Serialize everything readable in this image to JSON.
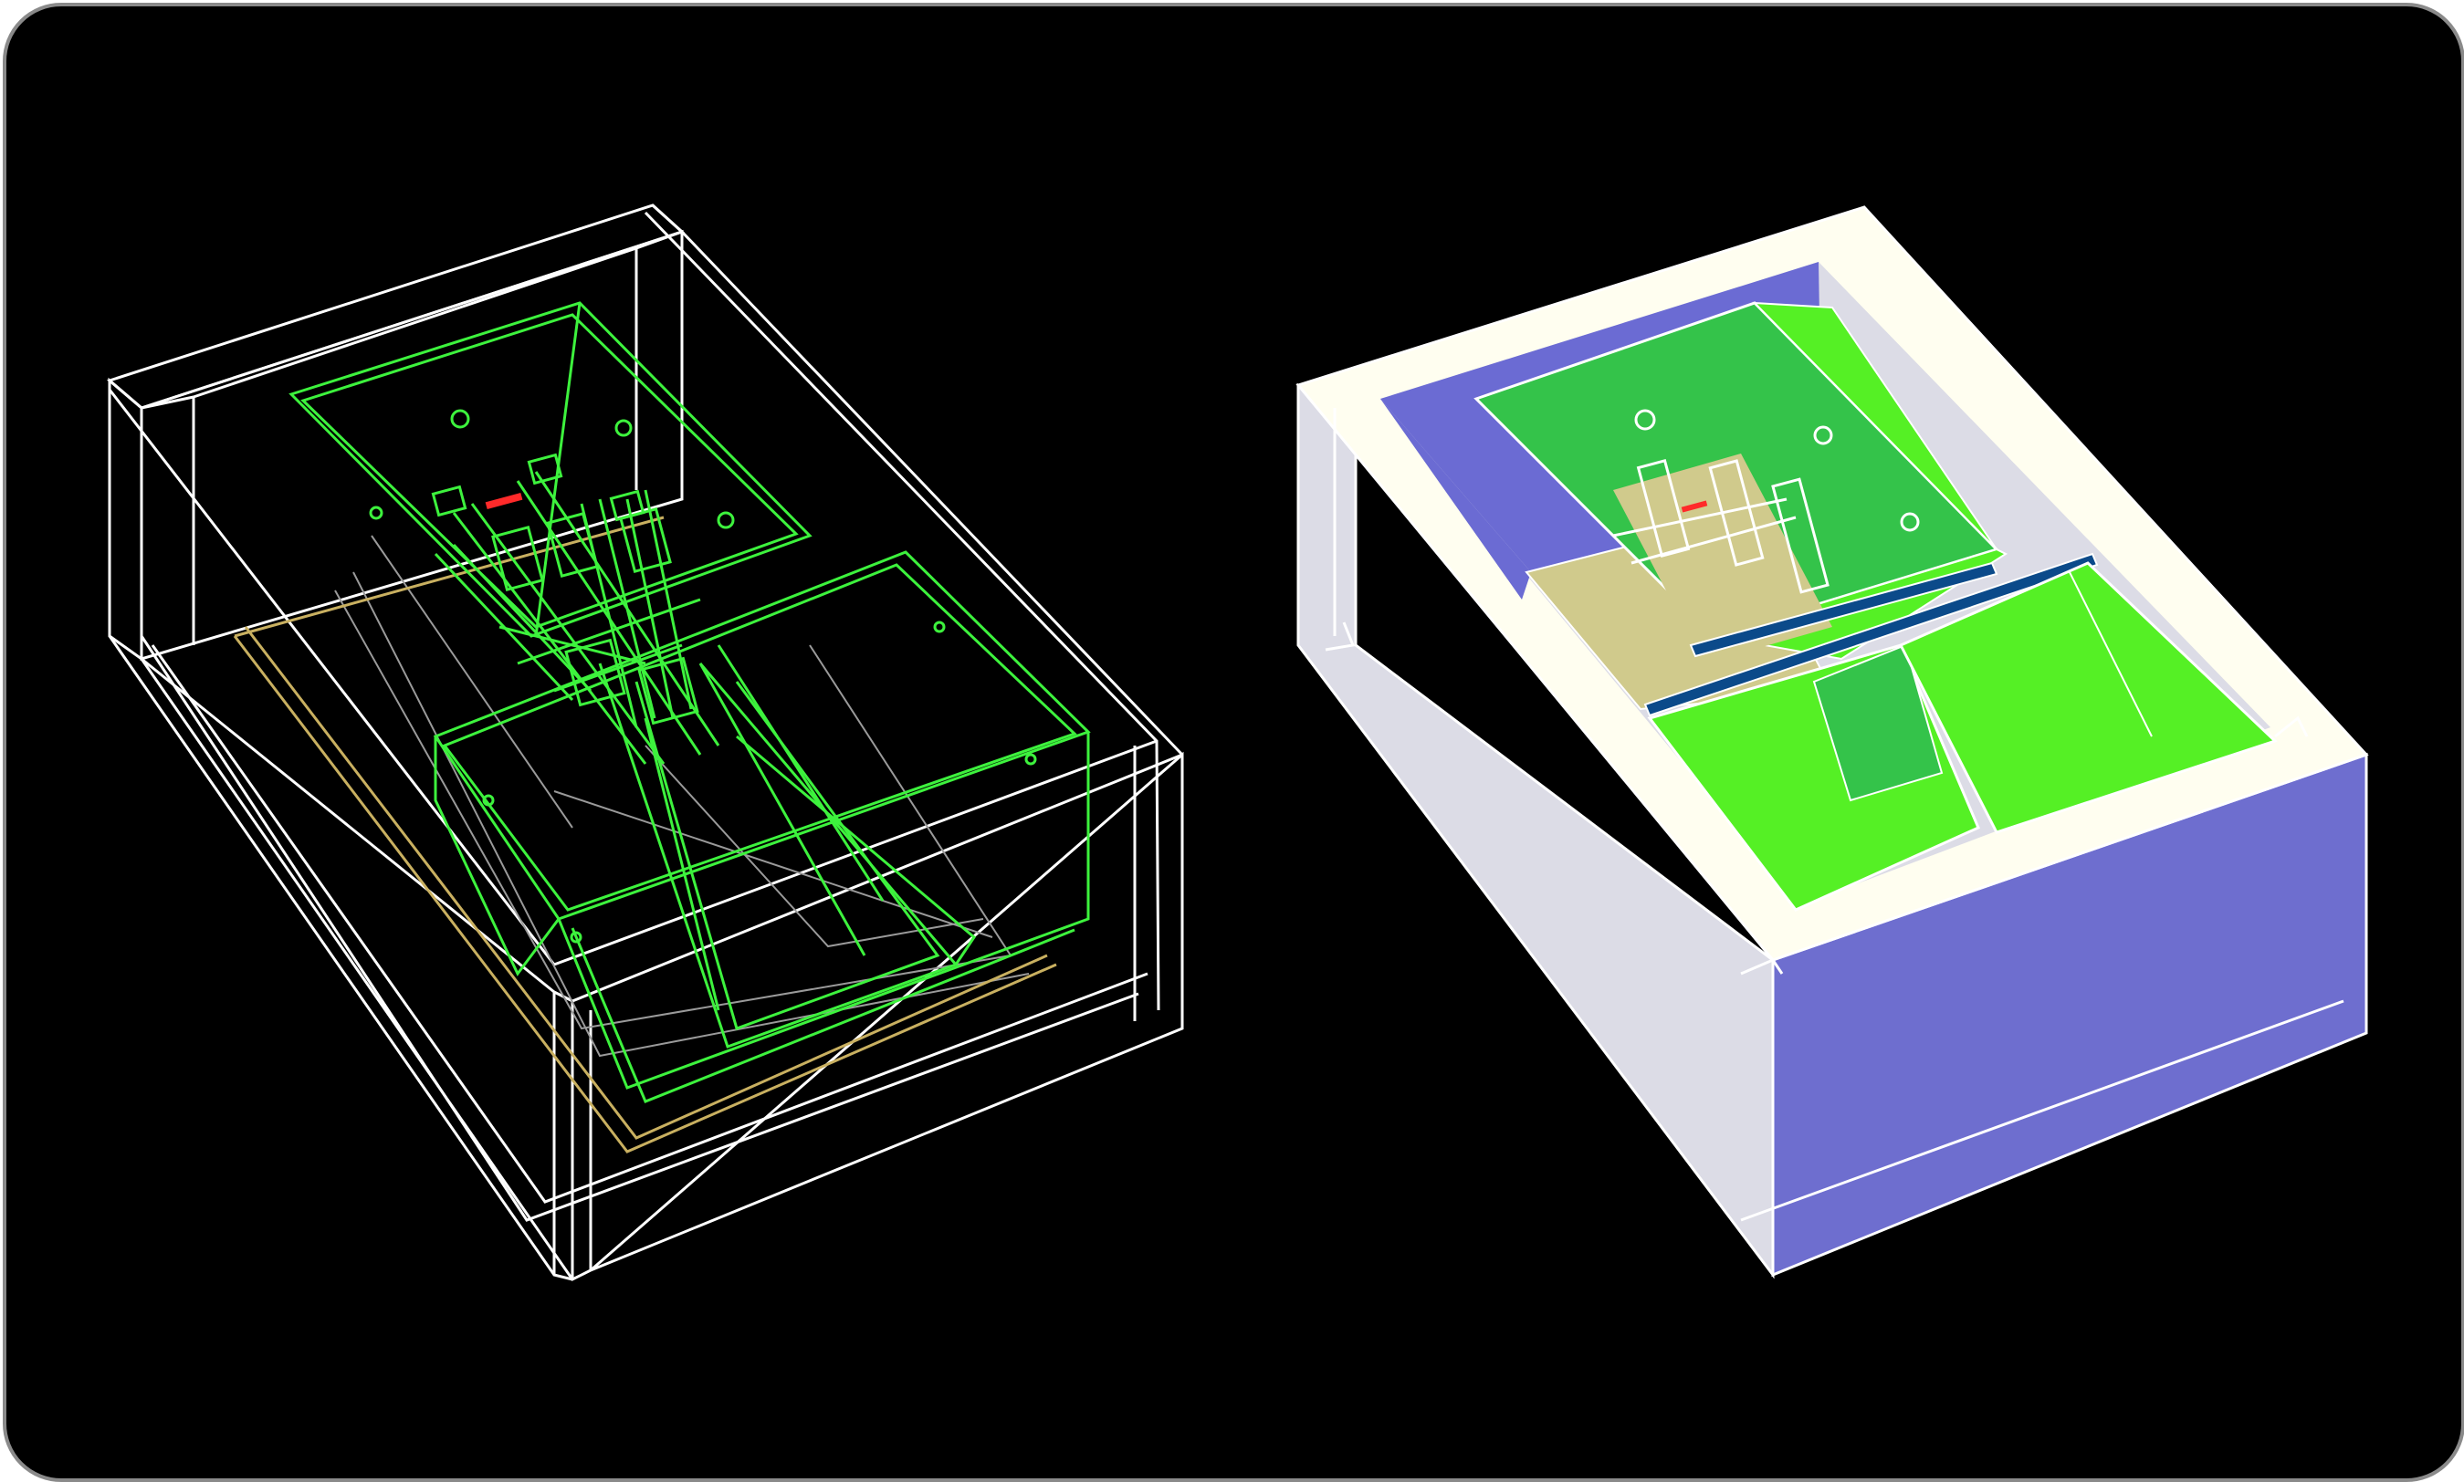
{
  "canvas": {
    "background": "#000000",
    "border_color": "#8a8a8a"
  },
  "views": [
    {
      "name": "wireframe-view",
      "render_mode": "wireframe",
      "colors": {
        "outer_box": "#ffffff",
        "inner_parts": "#3df23d",
        "hidden_lines": "#9a9a9a",
        "base_plate": "#c9b060",
        "marker": "#ff2a2a"
      }
    },
    {
      "name": "shaded-view",
      "render_mode": "shaded",
      "colors": {
        "rim": "#fffef0",
        "side_grey": "#dcdce6",
        "side_blue": "#6e6ecf",
        "inner_blue": "#6b6bd3",
        "funnel_green": "#55f025",
        "funnel_green_dark": "#34c34a",
        "funnel_tan": "#d0ca8c",
        "divider_blue": "#0b4a8a",
        "edge": "#ffffff"
      }
    }
  ]
}
